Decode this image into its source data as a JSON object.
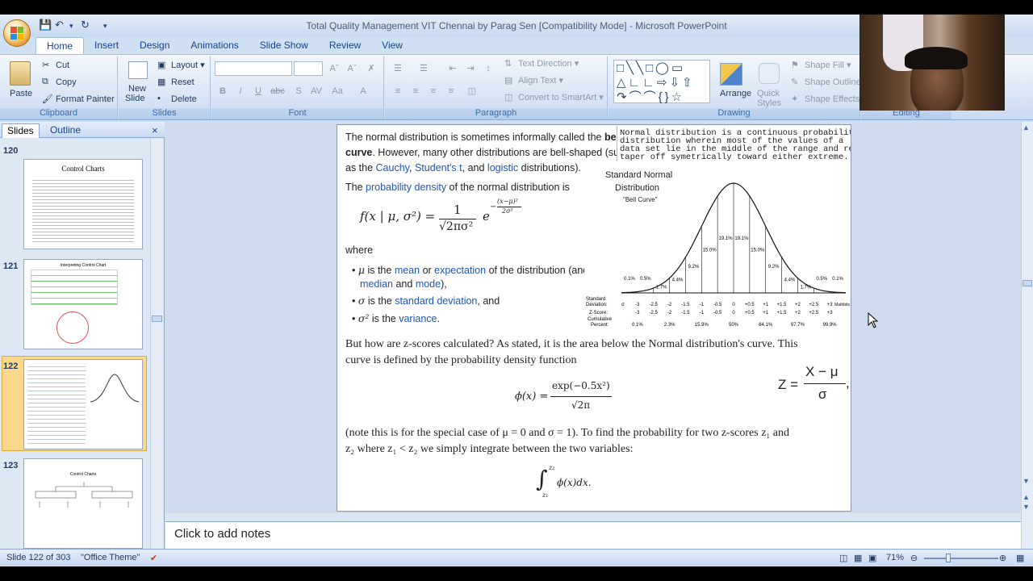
{
  "window": {
    "title": "Total Quality Management VIT Chennai by Parag Sen [Compatibility Mode] - Microsoft PowerPoint"
  },
  "qat": {
    "save": "save-icon",
    "undo": "undo-icon",
    "redo": "redo-icon"
  },
  "tabs": [
    "Home",
    "Insert",
    "Design",
    "Animations",
    "Slide Show",
    "Review",
    "View"
  ],
  "ribbon": {
    "clipboard": {
      "label": "Clipboard",
      "paste": "Paste",
      "cut": "Cut",
      "copy": "Copy",
      "format_painter": "Format Painter"
    },
    "slides": {
      "label": "Slides",
      "new_slide": "New",
      "new_slide2": "Slide",
      "layout": "Layout",
      "reset": "Reset",
      "delete": "Delete"
    },
    "font": {
      "label": "Font",
      "bold": "B",
      "italic": "I",
      "underline": "U",
      "strike": "abc",
      "shadow": "S",
      "spacing": "AV",
      "case": "Aa"
    },
    "paragraph": {
      "label": "Paragraph",
      "text_direction": "Text Direction",
      "align_text": "Align Text",
      "smartart": "Convert to SmartArt"
    },
    "drawing": {
      "label": "Drawing",
      "arrange": "Arrange",
      "quick_styles": "Quick",
      "quick_styles2": "Styles",
      "shape_fill": "Shape Fill",
      "shape_outline": "Shape Outline",
      "shape_effects": "Shape Effects"
    },
    "editing": {
      "label": "Editing"
    }
  },
  "panel": {
    "tab_slides": "Slides",
    "tab_outline": "Outline",
    "close": "×",
    "thumbs": [
      {
        "num": "120",
        "title": "Control Charts"
      },
      {
        "num": "121",
        "title": "Interpreting Control Chart"
      },
      {
        "num": "122",
        "title": ""
      },
      {
        "num": "123",
        "title": "Control Charts"
      }
    ]
  },
  "slide": {
    "p1a": "The normal distribution is sometimes informally called the ",
    "p1b": "bell",
    "p2a": "curve",
    "p2b": ". However, many other distributions are bell-shaped (such",
    "p3a": "as the ",
    "p3_cauchy": "Cauchy",
    "p3_comma": ", ",
    "p3_student": "Student's t",
    "p3_and": ", and ",
    "p3_logistic": "logistic",
    "p3_end": " distributions).",
    "p4a": "The ",
    "p4_link": "probability density",
    "p4b": " of the normal distribution is",
    "formula1_lhs": "f(x | μ, σ²) =",
    "formula1_num": "1",
    "formula1_den": "√2πσ²",
    "formula1_e": "e",
    "formula1_exp_num": "(x−μ)²",
    "formula1_exp_den": "2σ²",
    "formula1_minus": "−",
    "where": "where",
    "b1_sym": "μ",
    "b1_a": " is the ",
    "b1_mean": "mean",
    "b1_or": " or ",
    "b1_exp": "expectation",
    "b1_b": " of the distribution (and a",
    "b1_median": "median",
    "b1_and": " and ",
    "b1_mode": "mode",
    "b1_end": "),",
    "b2_sym": "σ",
    "b2_a": " is the ",
    "b2_sd": "standard deviation",
    "b2_b": ", and",
    "b3_sym": "σ²",
    "b3_a": " is the ",
    "b3_var": "variance",
    "b3_end": ".",
    "zq1": "But how are z-scores calculated? As stated, it is the area below the Normal distribution's curve. This",
    "zq2": "curve is defined by the probability density function",
    "phi_lhs": "ϕ(x) =",
    "phi_num": "exp(−0.5x²)",
    "phi_den": "√2π",
    "z_lhs": "Z =",
    "z_num": "X − μ",
    "z_den": "σ",
    "z_comma": ",",
    "note1": "(note this is for the special case of μ = 0 and σ = 1). To find the probability for two z-scores z₁ and",
    "note2": "z₂ where z₁ < z₂ we simply integrate between the two variables:",
    "integral": "∫",
    "int_upper": "z₂",
    "int_lower": "z₁",
    "int_body": "ϕ(x)dx.",
    "mono1": "Normal distribution is a continuous probability",
    "mono2": "distribution wherein most of the values of a",
    "mono3": "data set lie in the middle of the range and rest",
    "mono4": "taper off symetrically toward either extreme."
  },
  "bell": {
    "title1": "Standard Normal",
    "title2": "Distribution",
    "subtitle": "\"Bell Curve\"",
    "pcts_left": [
      "0.1%",
      "0.5%",
      "1.7%",
      "4.4%",
      "9.2%",
      "15.0%",
      "19.1%"
    ],
    "pcts_right": [
      "19.1%",
      "15.0%",
      "9.2%",
      "4.4%",
      "1.7%",
      "0.5%",
      "0.1%"
    ],
    "sd_label1": "Standard",
    "sd_label2": "Deviation:",
    "sd_values": [
      "σ",
      "-3",
      "-2.5",
      "-2",
      "-1.5",
      "-1",
      "-0.5",
      "0",
      "+0.5",
      "+1",
      "+1.5",
      "+2",
      "+2.5",
      "+3"
    ],
    "sd_end": "Mathbits",
    "z_label": "Z-Score:",
    "z_values": [
      "-3",
      "-2.5",
      "-2",
      "-1.5",
      "-1",
      "-0.5",
      "0",
      "+0.5",
      "+1",
      "+1.5",
      "+2",
      "+2.5",
      "+3"
    ],
    "cum_label1": "Cumulative",
    "cum_label2": "Percent:",
    "cum_values": [
      "0.1%",
      "2.3%",
      "15.9%",
      "50%",
      "84.1%",
      "97.7%",
      "99.9%"
    ]
  },
  "notes": {
    "placeholder": "Click to add notes"
  },
  "status": {
    "slide": "Slide 122 of 303",
    "theme": "\"Office Theme\"",
    "zoom": "71%"
  },
  "colors": {
    "accent": "#15428b",
    "ribbon": "#dbe7f6",
    "selected_thumb": "#fbd98c",
    "link": "#1f57b5"
  }
}
